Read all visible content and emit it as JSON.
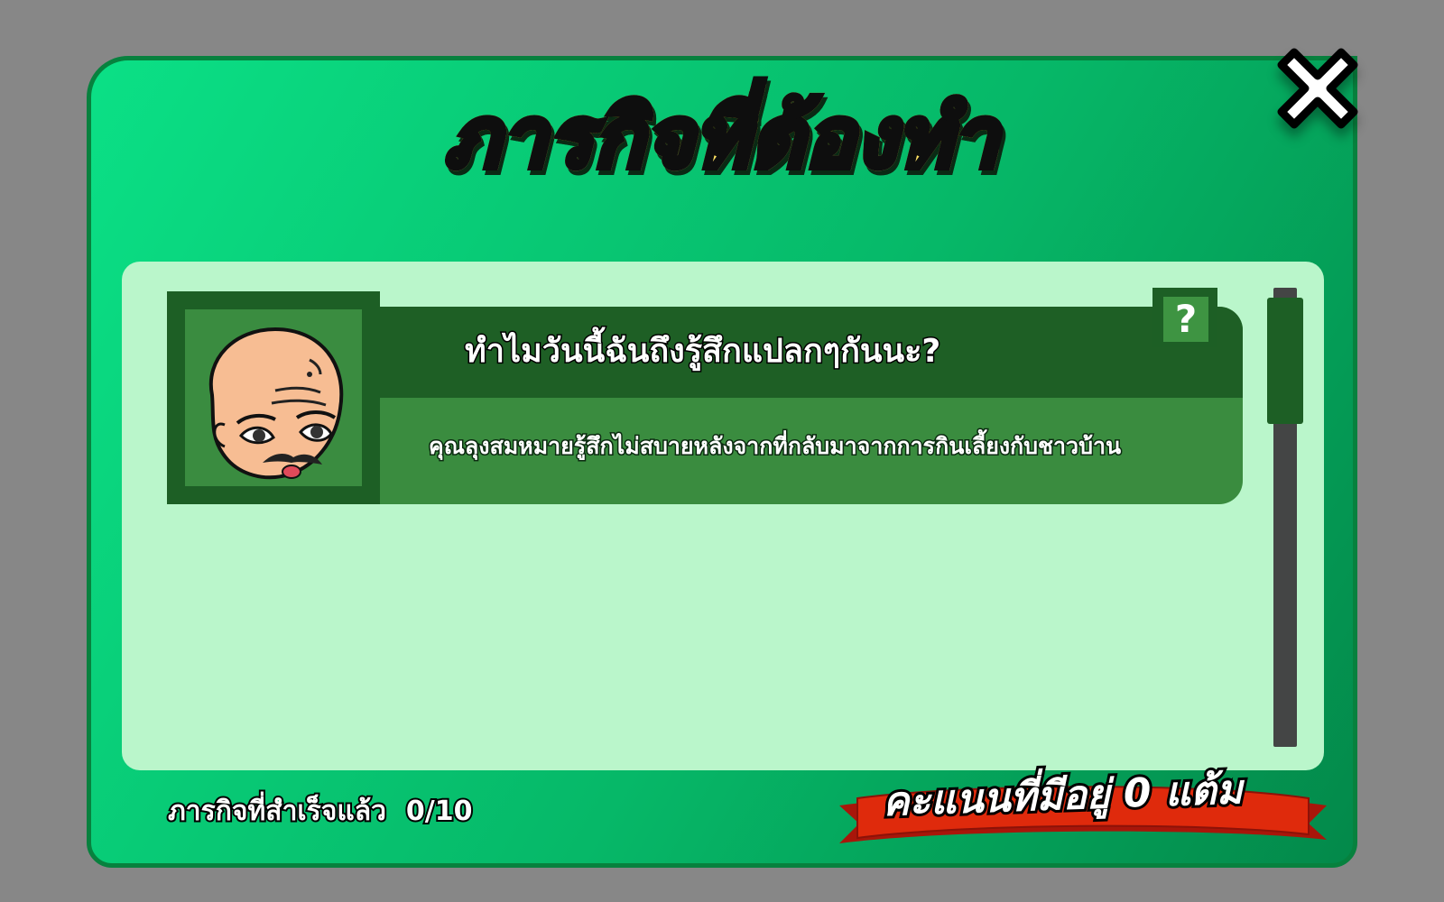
{
  "dialog": {
    "title": "ภารกิจที่ต้องทำ",
    "close_icon": "close-x-icon"
  },
  "quests": [
    {
      "title": "ทำไมวันนี้ฉันถึงรู้สึกแปลกๆกันนะ?",
      "description": "คุณลุงสมหมายรู้สึกไม่สบายหลังจากที่กลับมาจากการกินเลี้ยงกับชาวบ้าน",
      "portrait": "old-man-portrait",
      "help_label": "?"
    }
  ],
  "footer": {
    "completed_label": "ภารกิจที่สำเร็จแล้ว",
    "completed_count": "0/10",
    "score_label": "คะแนนที่มีอยู่ 0 แต้ม"
  },
  "colors": {
    "background": "#878787",
    "modal_green": "#06b868",
    "panel": "#baf6cb",
    "dark_green": "#1d5f25",
    "mid_green": "#3a8c3f",
    "title_yellow": "#ffd21a",
    "ribbon_red": "#d8230a"
  }
}
